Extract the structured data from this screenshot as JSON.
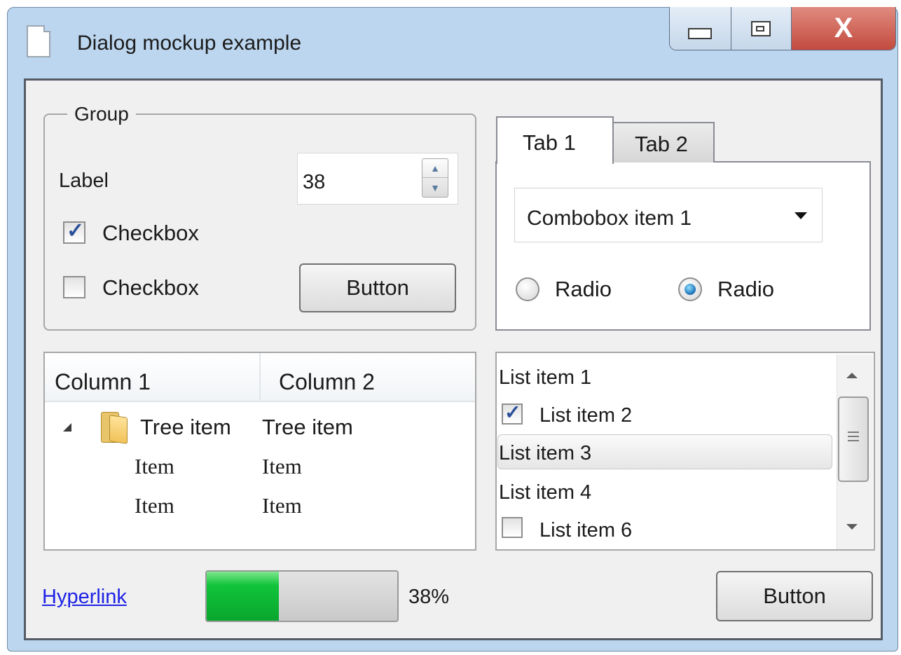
{
  "window": {
    "title": "Dialog mockup example",
    "close_label": "X"
  },
  "group": {
    "title": "Group",
    "label": "Label",
    "spin_value": "38",
    "checkbox_1": {
      "label": "Checkbox",
      "checked": true
    },
    "checkbox_2": {
      "label": "Checkbox",
      "checked": false
    },
    "button_label": "Button"
  },
  "tabs": {
    "items": [
      {
        "label": "Tab 1",
        "selected": true
      },
      {
        "label": "Tab 2",
        "selected": false
      }
    ],
    "combobox_value": "Combobox item 1",
    "radio_1": {
      "label": "Radio",
      "selected": false
    },
    "radio_2": {
      "label": "Radio",
      "selected": true
    }
  },
  "tree": {
    "columns": [
      "Column 1",
      "Column 2"
    ],
    "rows": [
      [
        "Tree item",
        "Tree item"
      ],
      [
        "Item",
        "Item"
      ],
      [
        "Item",
        "Item"
      ]
    ]
  },
  "list": {
    "items": [
      {
        "label": "List item 1",
        "checkbox": false
      },
      {
        "label": "List item 2",
        "checkbox": true,
        "checked": true
      },
      {
        "label": "List item 3",
        "selected": true
      },
      {
        "label": "List item 4",
        "checkbox": false
      },
      {
        "label": "List item 6",
        "checkbox": true,
        "checked": false
      }
    ]
  },
  "footer": {
    "hyperlink": "Hyperlink",
    "progress": 0.38,
    "progress_text": "38%",
    "button_label": "Button"
  },
  "colors": {
    "accent_green": "#10c43a",
    "link_blue": "#1e22e6",
    "close_red": "#c34a3e"
  },
  "icons": [
    "document-icon",
    "minimize-icon",
    "maximize-icon",
    "close-icon",
    "folder-icon",
    "spin-up-icon",
    "spin-down-icon",
    "dropdown-arrow-icon",
    "expand-triangle-icon",
    "check-icon"
  ]
}
